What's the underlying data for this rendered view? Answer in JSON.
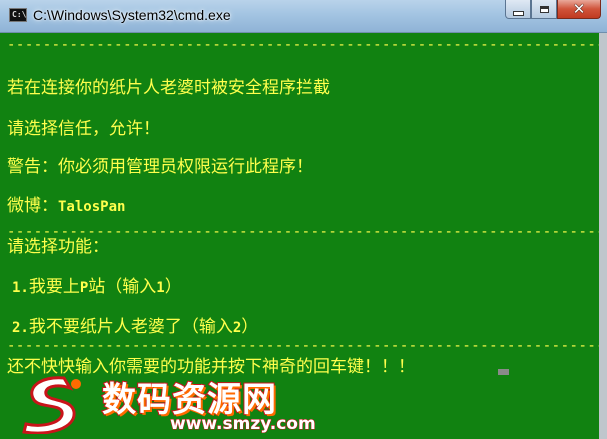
{
  "window": {
    "title": "C:\\Windows\\System32\\cmd.exe",
    "icon": "console-app-icon",
    "controls": [
      "minimize-icon",
      "maximize-icon",
      "close-icon"
    ]
  },
  "console": {
    "background": "#118211",
    "text_color": "#ffff4d",
    "separator": "----------------------------------------------------------------------------------------",
    "lines": {
      "warning_blocked": "若在连接你的纸片人老婆时被安全程序拦截",
      "choose_trust": "请选择信任，允许！",
      "admin_warning": "警告：你必须用管理员权限运行此程序！",
      "weibo_label": "微博：",
      "weibo_handle": "TalosPan",
      "choose_function": "请选择功能：",
      "option1_num": "1.",
      "option1_text": "我要上",
      "option1_p": "P",
      "option1_tail": "站（输入",
      "option1_input": "1",
      "option1_close": "）",
      "option2_num": "2.",
      "option2_text": "我不要纸片人老婆了（输入",
      "option2_input": "2",
      "option2_close": "）",
      "prompt": "还不快快输入你需要的功能并按下神奇的回车键！！！"
    }
  },
  "watermark": {
    "name": "数码资源网",
    "url": "www.smzy.com",
    "colors": {
      "fill": "#ffffff",
      "stroke": "#c9141a",
      "accent": "#ff6a00"
    }
  }
}
